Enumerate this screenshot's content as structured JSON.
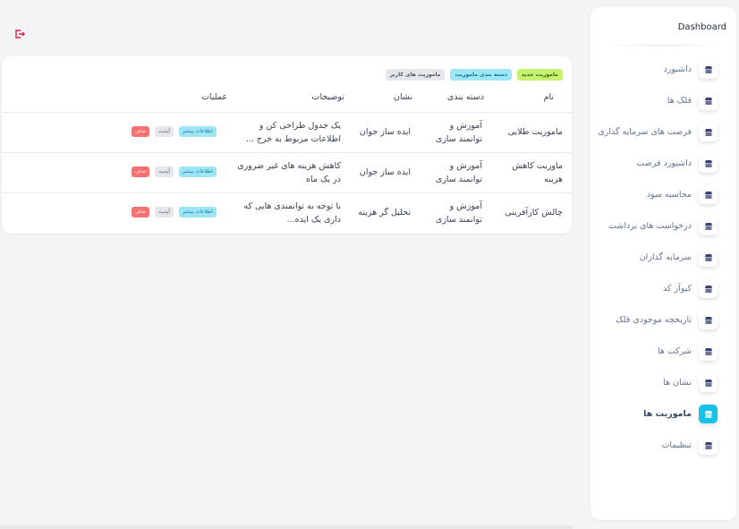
{
  "colors": {
    "accent": "#17c1e8",
    "logout": "#e11d48",
    "tag_green": "#c6f36f",
    "tag_cyan": "#9ee6f5",
    "danger": "#f87171"
  },
  "header": {
    "logout_icon": "logout-icon"
  },
  "sidebar": {
    "brand": "Dashboard",
    "items": [
      {
        "label": "داشبورد",
        "icon": "shop-icon",
        "active": false
      },
      {
        "label": "قلک ها",
        "icon": "shop-icon",
        "active": false
      },
      {
        "label": "فرصت های سرمایه گذاری",
        "icon": "shop-icon",
        "active": false
      },
      {
        "label": "داشبورد فرصت",
        "icon": "shop-icon",
        "active": false
      },
      {
        "label": "محاسبه سود",
        "icon": "shop-icon",
        "active": false
      },
      {
        "label": "درخواست های برداشت",
        "icon": "shop-icon",
        "active": false
      },
      {
        "label": "سرمایه گذاران",
        "icon": "shop-icon",
        "active": false
      },
      {
        "label": "کیوآر کد",
        "icon": "shop-icon",
        "active": false
      },
      {
        "label": "تاریخچه موجودی قلک",
        "icon": "shop-icon",
        "active": false
      },
      {
        "label": "شرکت ها",
        "icon": "shop-icon",
        "active": false
      },
      {
        "label": "نشان ها",
        "icon": "shop-icon",
        "active": false
      },
      {
        "label": "ماموریت ها",
        "icon": "shop-icon",
        "active": true
      },
      {
        "label": "تنظیمات",
        "icon": "shop-icon",
        "active": false
      }
    ]
  },
  "main": {
    "tags": {
      "new_mission": "ماموریت جدید",
      "mission_category": "دسته بندی ماموریت",
      "user_missions": "ماموریت های کاربر"
    },
    "table": {
      "headers": {
        "name": "نام",
        "category": "دسته بندی",
        "badge": "نشان",
        "description": "توضیحات",
        "actions": "عملیات"
      },
      "actions": {
        "more": "اطلاعات بیشتر",
        "update": "آپدیت",
        "delete": "حذف"
      },
      "rows": [
        {
          "name": "ماموریت طلایی",
          "category": "آموزش و توانمند سازی",
          "badge": "ایده ساز جوان",
          "description": "یک جدول طراحی کن و اطلاعات مربوط به خرج ..."
        },
        {
          "name": "ماوریت کاهش هزینه",
          "category": "آموزش و توانمند سازی",
          "badge": "ایده ساز جوان",
          "description": "کاهش هزینه های غیر ضروری در یک ماه"
        },
        {
          "name": "چالش کارآفرینی",
          "category": "آموزش و توانمند سازی",
          "badge": "تحلیل گر هزینه",
          "description": "با توجه به توانمندی هایی که داری یک ایده..."
        }
      ]
    }
  }
}
